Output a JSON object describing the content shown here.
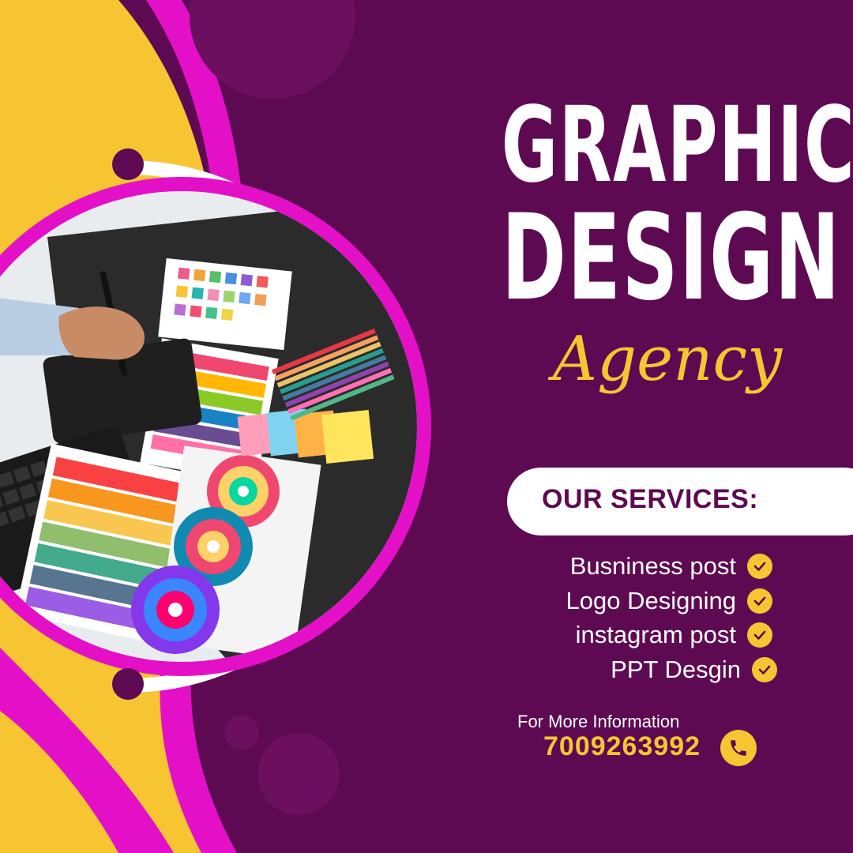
{
  "title": {
    "line1": "GRAPHIC",
    "line2": "DESIGN",
    "line3": "Agency"
  },
  "services": {
    "heading": "OUR SERVICES:",
    "items": [
      {
        "label": "Busniness post"
      },
      {
        "label": "Logo Designing"
      },
      {
        "label": "instagram post"
      },
      {
        "label": "PPT Desgin"
      }
    ]
  },
  "contact": {
    "label": "For More Information",
    "phone": "7009263992"
  },
  "icons": {
    "check": "check-circle-icon",
    "phone": "phone-icon"
  },
  "colors": {
    "background": "#5e0a52",
    "yellow": "#f7c531",
    "magenta": "#e310c8",
    "white": "#ffffff"
  }
}
